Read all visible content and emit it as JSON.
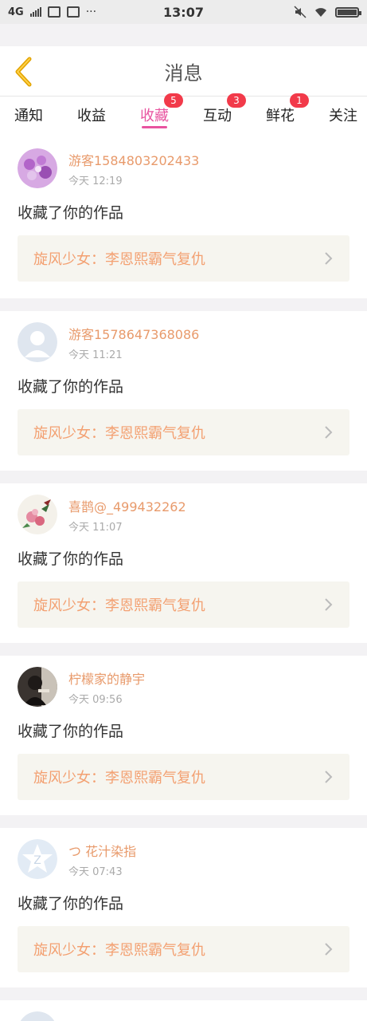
{
  "status_bar": {
    "network": "4G",
    "time": "13:07",
    "more": "···"
  },
  "header": {
    "title": "消息"
  },
  "tabs": [
    {
      "label": "通知",
      "badge": ""
    },
    {
      "label": "收益",
      "badge": ""
    },
    {
      "label": "收藏",
      "badge": "5"
    },
    {
      "label": "互动",
      "badge": "3"
    },
    {
      "label": "鲜花",
      "badge": "1"
    },
    {
      "label": "关注",
      "badge": ""
    }
  ],
  "active_tab": "收藏",
  "colors": {
    "accent": "#e8539f",
    "username": "#e89a6b",
    "work_title": "#f3a071",
    "badge": "#f23a4a"
  },
  "messages": [
    {
      "username": "游客1584803202433",
      "time": "今天 12:19",
      "action": "收藏了你的作品",
      "work": "旋风少女：李恩熙霸气复仇"
    },
    {
      "username": "游客1578647368086",
      "time": "今天 11:21",
      "action": "收藏了你的作品",
      "work": "旋风少女：李恩熙霸气复仇"
    },
    {
      "username": "喜鹊@_499432262",
      "time": "今天 11:07",
      "action": "收藏了你的作品",
      "work": "旋风少女：李恩熙霸气复仇"
    },
    {
      "username": "柠檬家的静宇",
      "time": "今天 09:56",
      "action": "收藏了你的作品",
      "work": "旋风少女：李恩熙霸气复仇"
    },
    {
      "username": "つ 花汁染指",
      "time": "今天 07:43",
      "action": "收藏了你的作品",
      "work": "旋风少女：李恩熙霸气复仇"
    }
  ]
}
